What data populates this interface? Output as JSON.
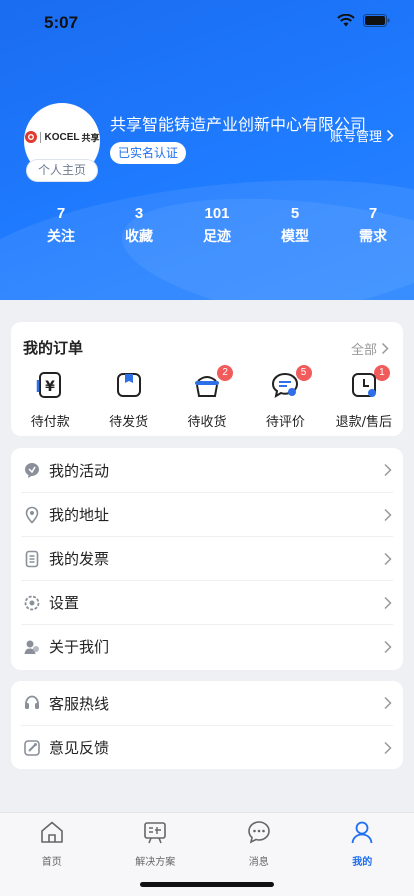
{
  "status_bar": {
    "time": "5:07"
  },
  "profile": {
    "company_name": "共享智能铸造产业创新中心有限公司",
    "verified_label": "已实名认证",
    "home_button": "个人主页",
    "account_link": "账号管理",
    "logo_text": "KOCEL 共享"
  },
  "stats": [
    {
      "value": "7",
      "label": "关注"
    },
    {
      "value": "3",
      "label": "收藏"
    },
    {
      "value": "101",
      "label": "足迹"
    },
    {
      "value": "5",
      "label": "模型"
    },
    {
      "value": "7",
      "label": "需求"
    }
  ],
  "orders": {
    "title": "我的订单",
    "all_label": "全部",
    "items": [
      {
        "label": "待付款",
        "icon": "payment-icon",
        "badge": ""
      },
      {
        "label": "待发货",
        "icon": "shipping-box-icon",
        "badge": ""
      },
      {
        "label": "待收货",
        "icon": "basket-icon",
        "badge": "2"
      },
      {
        "label": "待评价",
        "icon": "review-icon",
        "badge": "5"
      },
      {
        "label": "退款/售后",
        "icon": "refund-clock-icon",
        "badge": "1"
      }
    ]
  },
  "menu_main": [
    {
      "label": "我的活动",
      "icon": "activity-icon"
    },
    {
      "label": "我的地址",
      "icon": "location-pin-icon"
    },
    {
      "label": "我的发票",
      "icon": "invoice-icon"
    },
    {
      "label": "设置",
      "icon": "settings-gear-icon"
    },
    {
      "label": "关于我们",
      "icon": "about-icon"
    }
  ],
  "menu_service": [
    {
      "label": "客服热线",
      "icon": "headset-icon"
    },
    {
      "label": "意见反馈",
      "icon": "feedback-icon"
    }
  ],
  "tabbar": [
    {
      "label": "首页",
      "icon": "home-icon",
      "active": false
    },
    {
      "label": "解决方案",
      "icon": "solution-board-icon",
      "active": false
    },
    {
      "label": "消息",
      "icon": "message-icon",
      "active": false
    },
    {
      "label": "我的",
      "icon": "user-icon",
      "active": true
    }
  ],
  "colors": {
    "primary": "#1f6ff0",
    "badge": "#f15b5b",
    "background": "#eef0f4"
  }
}
